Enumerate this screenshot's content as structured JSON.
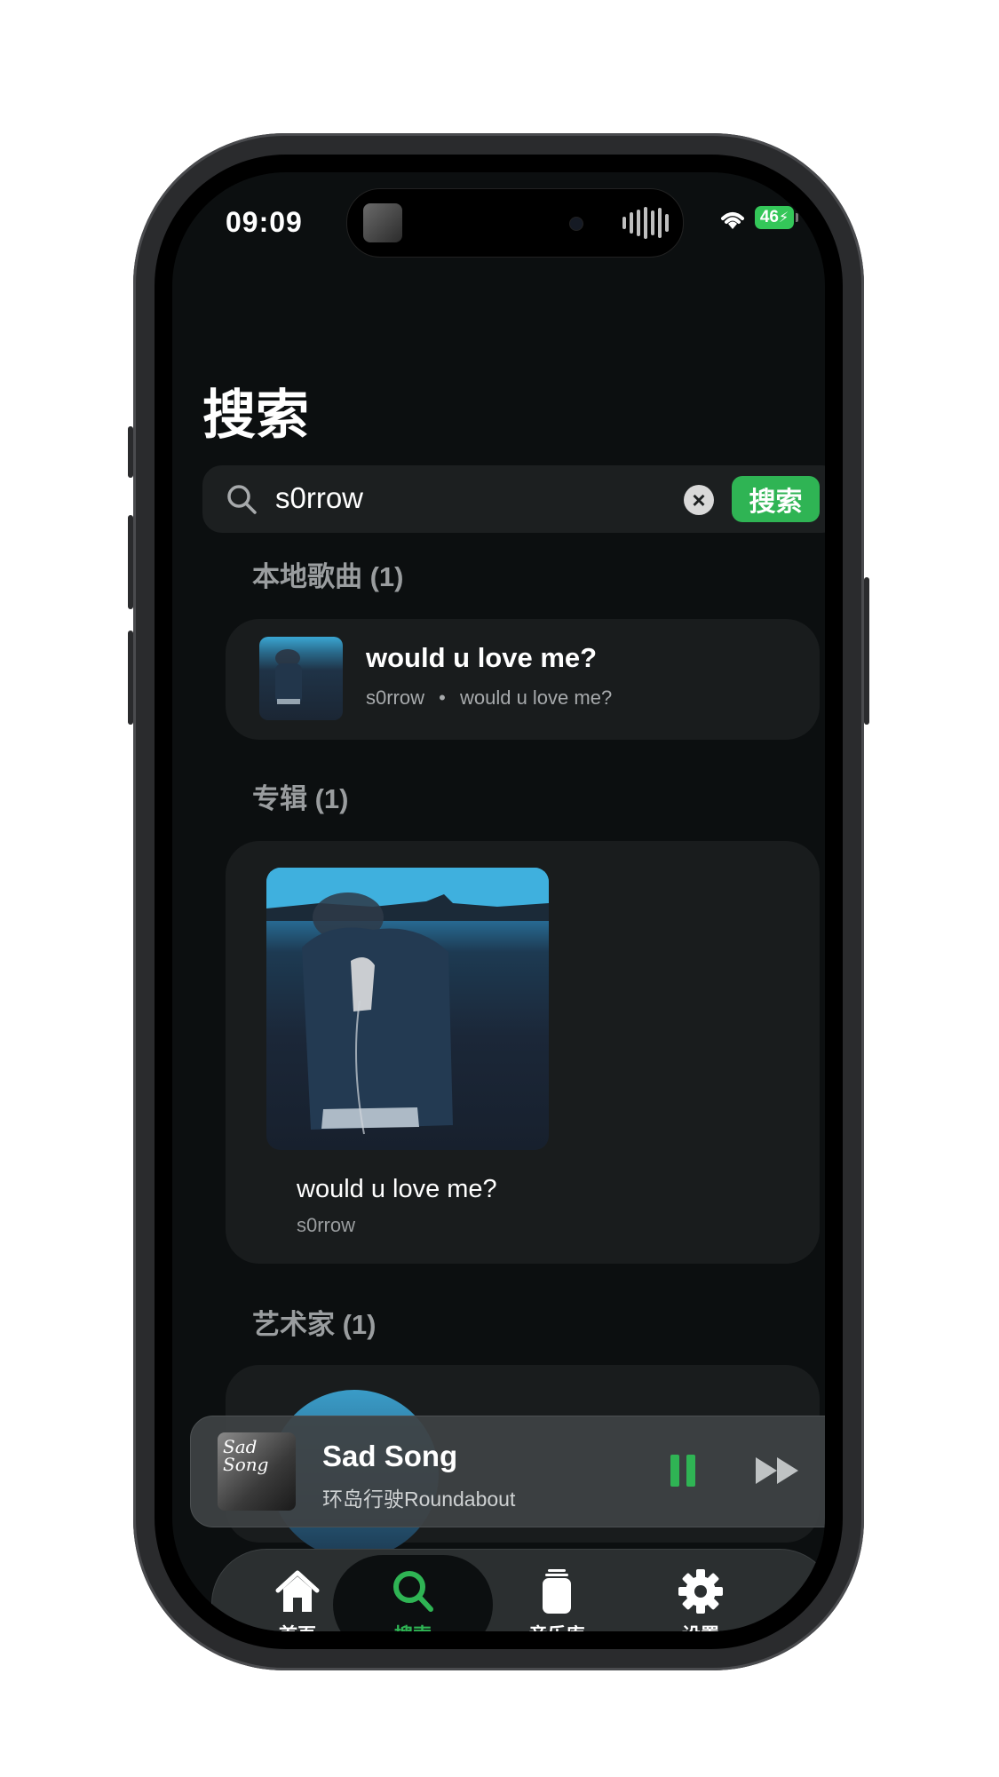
{
  "status_bar": {
    "time": "09:09",
    "battery": "46"
  },
  "page": {
    "title": "搜索"
  },
  "search": {
    "query": "s0rrow",
    "button_label": "搜索"
  },
  "sections": {
    "local_songs": {
      "header": "本地歌曲 (1)"
    },
    "albums": {
      "header": "专辑 (1)"
    },
    "artists": {
      "header": "艺术家 (1)"
    }
  },
  "song_result": {
    "title": "would u love me?",
    "artist": "s0rrow",
    "separator": "•",
    "album": "would u love me?"
  },
  "album_result": {
    "title": "would u love me?",
    "artist": "s0rrow"
  },
  "now_playing": {
    "title": "Sad Song",
    "artist": "环岛行驶Roundabout",
    "art_text": "Sad Song",
    "state": "playing"
  },
  "tab_bar": {
    "active": "search",
    "tabs": [
      {
        "id": "home",
        "label": "首页",
        "icon": "house-icon"
      },
      {
        "id": "search",
        "label": "搜索",
        "icon": "search-icon"
      },
      {
        "id": "library",
        "label": "音乐库",
        "icon": "library-icon"
      },
      {
        "id": "settings",
        "label": "设置",
        "icon": "gear-icon"
      }
    ]
  },
  "colors": {
    "accent": "#2fb454",
    "background": "#0c0f10",
    "card": "#191c1d"
  }
}
